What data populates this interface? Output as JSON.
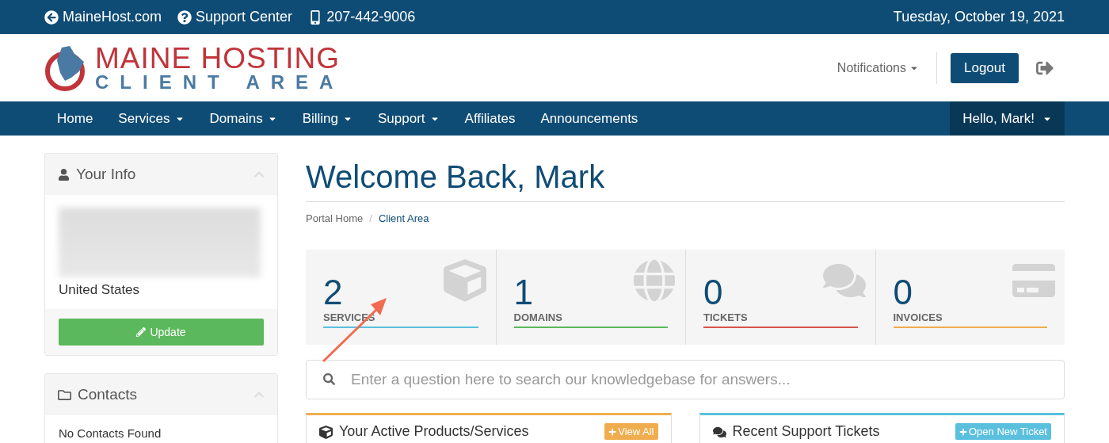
{
  "top_bar": {
    "links": [
      {
        "kind": "back",
        "text": "MaineHost.com"
      },
      {
        "kind": "help",
        "text": "Support Center"
      },
      {
        "kind": "phone",
        "text": "207-442-9006"
      }
    ],
    "date": "Tuesday, October 19, 2021"
  },
  "header": {
    "logo": {
      "title": "MAINE HOSTING",
      "subtitle": "CLIENT AREA"
    },
    "notifications": "Notifications",
    "logout": "Logout"
  },
  "nav": {
    "items": [
      {
        "label": "Home",
        "dropdown": false
      },
      {
        "label": "Services",
        "dropdown": true
      },
      {
        "label": "Domains",
        "dropdown": true
      },
      {
        "label": "Billing",
        "dropdown": true
      },
      {
        "label": "Support",
        "dropdown": true
      },
      {
        "label": "Affiliates",
        "dropdown": false
      },
      {
        "label": "Announcements",
        "dropdown": false
      }
    ],
    "user_menu": "Hello, Mark!"
  },
  "sidebar": {
    "panels": [
      {
        "kind": "info",
        "title": "Your Info",
        "country": "United States",
        "button": "Update"
      },
      {
        "kind": "contacts",
        "title": "Contacts",
        "empty_text": "No Contacts Found"
      }
    ]
  },
  "main": {
    "title": "Welcome Back, Mark",
    "breadcrumb_separator": "/",
    "breadcrumb": [
      {
        "label": "Portal Home",
        "selected": false
      },
      {
        "label": "Client Area",
        "selected": true
      }
    ],
    "stats": [
      {
        "kind": "services",
        "count": "2",
        "label": "SERVICES",
        "color": "#5bc0de"
      },
      {
        "kind": "domains",
        "count": "1",
        "label": "DOMAINS",
        "color": "#5cb85c"
      },
      {
        "kind": "tickets",
        "count": "0",
        "label": "TICKETS",
        "color": "#d9534f"
      },
      {
        "kind": "invoices",
        "count": "0",
        "label": "INVOICES",
        "color": "#f0ad4e"
      }
    ],
    "search": {
      "placeholder": "Enter a question here to search our knowledgebase for answers..."
    },
    "panels": [
      {
        "kind": "products",
        "title": "Your Active Products/Services",
        "action": "View All",
        "color": "#f0ad4e"
      },
      {
        "kind": "tickets",
        "title": "Recent Support Tickets",
        "action": "Open New Ticket",
        "color": "#5bc0de"
      }
    ]
  }
}
